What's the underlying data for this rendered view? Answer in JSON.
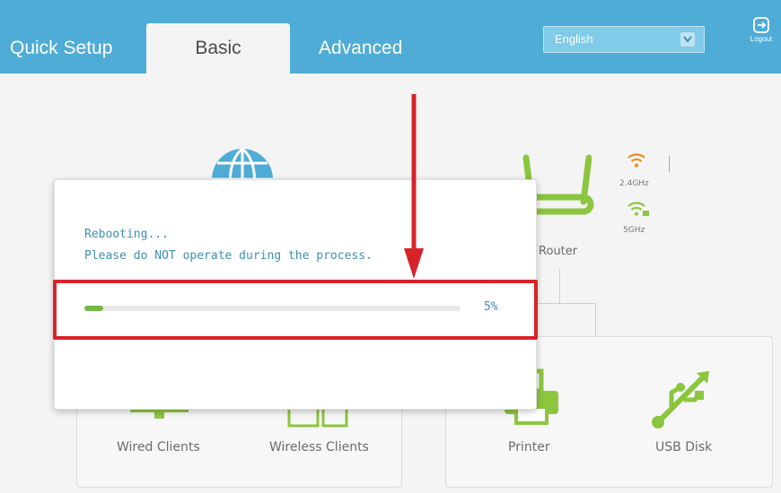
{
  "nav": {
    "tabs": [
      {
        "label": "Quick Setup",
        "active": false
      },
      {
        "label": "Basic",
        "active": true
      },
      {
        "label": "Advanced",
        "active": false
      }
    ],
    "language": {
      "selected": "English"
    },
    "logout_label": "Logout"
  },
  "diagram": {
    "router_label": "Router",
    "band_24": "2.4GHz",
    "band_5": "5GHz",
    "clients": [
      {
        "label": "Wired Clients"
      },
      {
        "label": "Wireless Clients"
      }
    ],
    "usb_devices": [
      {
        "label": "Printer"
      },
      {
        "label": "USB Disk"
      }
    ]
  },
  "dialog": {
    "line1": "Rebooting...",
    "line2": "Please do NOT operate during the process.",
    "progress_fraction": 0.05,
    "progress_text": "5%"
  },
  "colors": {
    "header_bg": "#4facd6",
    "accent_text": "#3d8fb4",
    "progress_fill": "#74b845",
    "router_green": "#8cc63f",
    "wifi_orange": "#f08c1e",
    "annotation_red": "#d8232a"
  },
  "icons": {
    "logout": "logout-icon",
    "globe": "globe-icon",
    "router": "router-icon",
    "printer": "printer-icon",
    "usb": "usb-icon",
    "dropdown": "chevron-down-icon"
  }
}
